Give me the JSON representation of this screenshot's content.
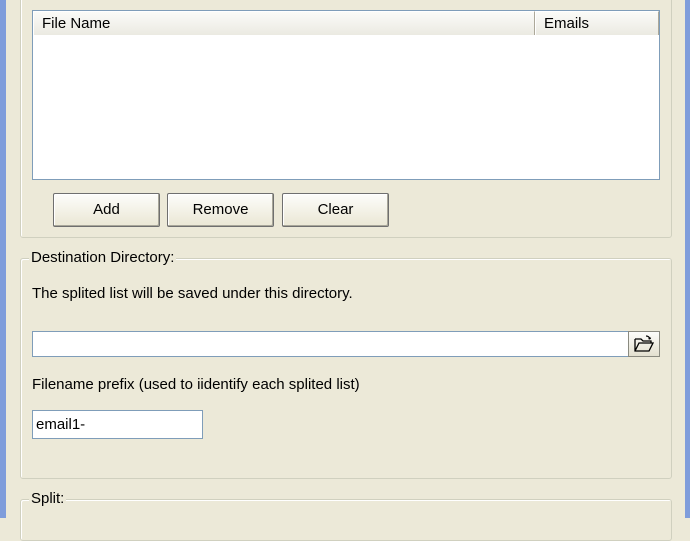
{
  "file_list": {
    "columns": [
      "File Name",
      "Emails"
    ],
    "rows": []
  },
  "buttons": {
    "add": "Add",
    "remove": "Remove",
    "clear": "Clear"
  },
  "destination": {
    "group_title": "Destination Directory:",
    "description": "The splited list will be saved under this directory.",
    "path_value": "",
    "prefix_label": "Filename prefix (used to iidentify each splited list)",
    "prefix_value": "email1-"
  },
  "split": {
    "group_title": "Split:"
  },
  "icons": {
    "browse": "open-folder-icon"
  },
  "colors": {
    "window_frame": "#7f9ddb",
    "dialog_bg": "#ece9d8",
    "field_border": "#7f9db9"
  }
}
